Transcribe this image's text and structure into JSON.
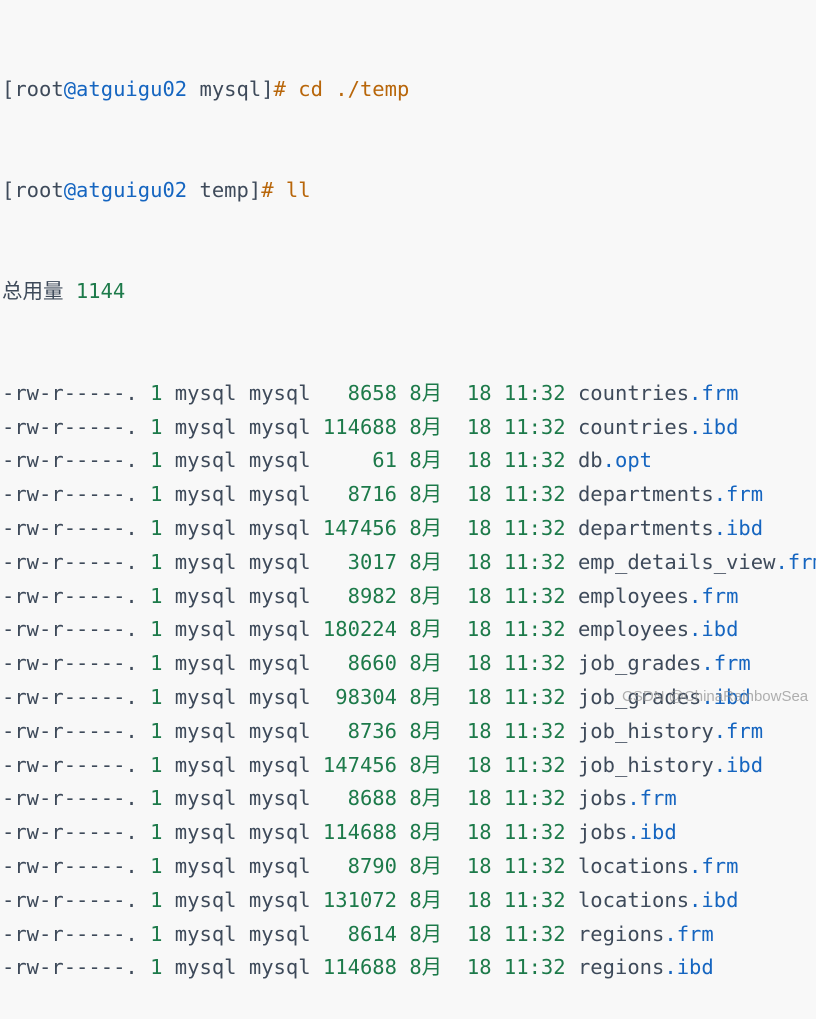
{
  "prompt1": {
    "bracket_open": "[",
    "user": "root",
    "host": "@atguigu02",
    "dir": " mysql]",
    "hash": "# ",
    "command": "cd ./temp"
  },
  "prompt2": {
    "bracket_open": "[",
    "user": "root",
    "host": "@atguigu02",
    "dir": " temp]",
    "hash": "# ",
    "command": "ll"
  },
  "total": {
    "label": "总用量",
    "value": "1144"
  },
  "files": [
    {
      "perm": "-rw-r-----.",
      "links": "1",
      "user": "mysql",
      "group": "mysql",
      "size": "8658",
      "month": "8月",
      "day": "18",
      "time": "11:32",
      "base": "countries",
      "ext": ".frm"
    },
    {
      "perm": "-rw-r-----.",
      "links": "1",
      "user": "mysql",
      "group": "mysql",
      "size": "114688",
      "month": "8月",
      "day": "18",
      "time": "11:32",
      "base": "countries",
      "ext": ".ibd"
    },
    {
      "perm": "-rw-r-----.",
      "links": "1",
      "user": "mysql",
      "group": "mysql",
      "size": "61",
      "month": "8月",
      "day": "18",
      "time": "11:32",
      "base": "db",
      "ext": ".opt"
    },
    {
      "perm": "-rw-r-----.",
      "links": "1",
      "user": "mysql",
      "group": "mysql",
      "size": "8716",
      "month": "8月",
      "day": "18",
      "time": "11:32",
      "base": "departments",
      "ext": ".frm"
    },
    {
      "perm": "-rw-r-----.",
      "links": "1",
      "user": "mysql",
      "group": "mysql",
      "size": "147456",
      "month": "8月",
      "day": "18",
      "time": "11:32",
      "base": "departments",
      "ext": ".ibd"
    },
    {
      "perm": "-rw-r-----.",
      "links": "1",
      "user": "mysql",
      "group": "mysql",
      "size": "3017",
      "month": "8月",
      "day": "18",
      "time": "11:32",
      "base": "emp_details_view",
      "ext": ".frm"
    },
    {
      "perm": "-rw-r-----.",
      "links": "1",
      "user": "mysql",
      "group": "mysql",
      "size": "8982",
      "month": "8月",
      "day": "18",
      "time": "11:32",
      "base": "employees",
      "ext": ".frm"
    },
    {
      "perm": "-rw-r-----.",
      "links": "1",
      "user": "mysql",
      "group": "mysql",
      "size": "180224",
      "month": "8月",
      "day": "18",
      "time": "11:32",
      "base": "employees",
      "ext": ".ibd"
    },
    {
      "perm": "-rw-r-----.",
      "links": "1",
      "user": "mysql",
      "group": "mysql",
      "size": "8660",
      "month": "8月",
      "day": "18",
      "time": "11:32",
      "base": "job_grades",
      "ext": ".frm"
    },
    {
      "perm": "-rw-r-----.",
      "links": "1",
      "user": "mysql",
      "group": "mysql",
      "size": "98304",
      "month": "8月",
      "day": "18",
      "time": "11:32",
      "base": "job_grades",
      "ext": ".ibd"
    },
    {
      "perm": "-rw-r-----.",
      "links": "1",
      "user": "mysql",
      "group": "mysql",
      "size": "8736",
      "month": "8月",
      "day": "18",
      "time": "11:32",
      "base": "job_history",
      "ext": ".frm"
    },
    {
      "perm": "-rw-r-----.",
      "links": "1",
      "user": "mysql",
      "group": "mysql",
      "size": "147456",
      "month": "8月",
      "day": "18",
      "time": "11:32",
      "base": "job_history",
      "ext": ".ibd"
    },
    {
      "perm": "-rw-r-----.",
      "links": "1",
      "user": "mysql",
      "group": "mysql",
      "size": "8688",
      "month": "8月",
      "day": "18",
      "time": "11:32",
      "base": "jobs",
      "ext": ".frm"
    },
    {
      "perm": "-rw-r-----.",
      "links": "1",
      "user": "mysql",
      "group": "mysql",
      "size": "114688",
      "month": "8月",
      "day": "18",
      "time": "11:32",
      "base": "jobs",
      "ext": ".ibd"
    },
    {
      "perm": "-rw-r-----.",
      "links": "1",
      "user": "mysql",
      "group": "mysql",
      "size": "8790",
      "month": "8月",
      "day": "18",
      "time": "11:32",
      "base": "locations",
      "ext": ".frm"
    },
    {
      "perm": "-rw-r-----.",
      "links": "1",
      "user": "mysql",
      "group": "mysql",
      "size": "131072",
      "month": "8月",
      "day": "18",
      "time": "11:32",
      "base": "locations",
      "ext": ".ibd"
    },
    {
      "perm": "-rw-r-----.",
      "links": "1",
      "user": "mysql",
      "group": "mysql",
      "size": "8614",
      "month": "8月",
      "day": "18",
      "time": "11:32",
      "base": "regions",
      "ext": ".frm"
    },
    {
      "perm": "-rw-r-----.",
      "links": "1",
      "user": "mysql",
      "group": "mysql",
      "size": "114688",
      "month": "8月",
      "day": "18",
      "time": "11:32",
      "base": "regions",
      "ext": ".ibd"
    }
  ],
  "watermark": "CSDN @ChinaRainbowSea",
  "colors": {
    "text": "#3e4a5a",
    "host": "#1565c0",
    "command": "#b8660a",
    "number": "#1d7a4a",
    "background": "#f8f8f8"
  }
}
